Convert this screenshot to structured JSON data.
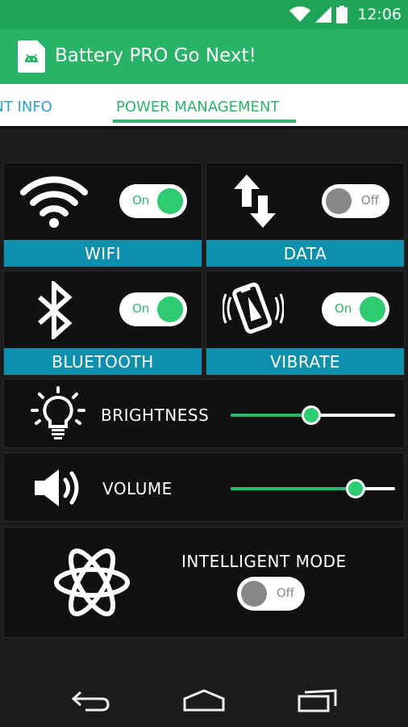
{
  "status_bar": {
    "time": "12:06"
  },
  "app_bar": {
    "title": "Battery PRO Go Next!"
  },
  "tabs": [
    {
      "label": "ENT INFO",
      "active": false
    },
    {
      "label": "POWER MANAGEMENT",
      "active": true
    }
  ],
  "toggles": {
    "wifi": {
      "label": "WIFI",
      "state": "On"
    },
    "data": {
      "label": "DATA",
      "state": "Off"
    },
    "bluetooth": {
      "label": "BLUETOOTH",
      "state": "On"
    },
    "vibrate": {
      "label": "VIBRATE",
      "state": "On"
    }
  },
  "brightness": {
    "label": "BRIGHTNESS",
    "level_fraction": 0.49
  },
  "volume": {
    "label": "VOLUME",
    "level_fraction": 0.76
  },
  "intelligent_mode": {
    "label": "INTELLIGENT MODE",
    "state": "Off"
  },
  "colors": {
    "status_bar": "#1ea55a",
    "app_bar": "#27b466",
    "accent_green": "#2dcc70",
    "label_bar": "#0e8fae",
    "tab_inactive": "#2a9fd6"
  }
}
